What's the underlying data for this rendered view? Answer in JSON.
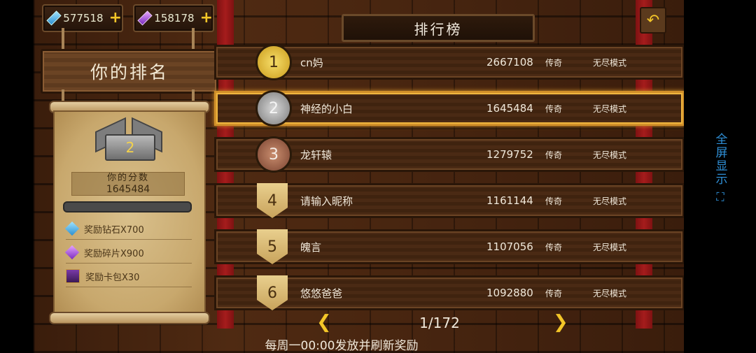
{
  "currency": {
    "diamonds": "577518",
    "shards": "158178",
    "plus": "+"
  },
  "left": {
    "title": "你的排名",
    "rank": "2",
    "score_label": "你的分数",
    "score": "1645484",
    "rewards": [
      {
        "icon": "diamond-icon",
        "label": "奖励钻石X700"
      },
      {
        "icon": "shard-icon",
        "label": "奖励碎片X900"
      },
      {
        "icon": "card-pack-icon",
        "label": "奖励卡包X30"
      }
    ]
  },
  "header": {
    "title": "排行榜",
    "back": "↶"
  },
  "leaderboard": [
    {
      "rank": "1",
      "name": "cn妈",
      "score": "2667108",
      "tier": "传奇",
      "mode": "无尽模式"
    },
    {
      "rank": "2",
      "name": "神经的小白",
      "score": "1645484",
      "tier": "传奇",
      "mode": "无尽模式"
    },
    {
      "rank": "3",
      "name": "龙轩辕",
      "score": "1279752",
      "tier": "传奇",
      "mode": "无尽模式"
    },
    {
      "rank": "4",
      "name": "请输入昵称",
      "score": "1161144",
      "tier": "传奇",
      "mode": "无尽模式"
    },
    {
      "rank": "5",
      "name": "魄言",
      "score": "1107056",
      "tier": "传奇",
      "mode": "无尽模式"
    },
    {
      "rank": "6",
      "name": "悠悠爸爸",
      "score": "1092880",
      "tier": "传奇",
      "mode": "无尽模式"
    }
  ],
  "pager": {
    "prev": "❮",
    "next": "❯",
    "page": "1/172"
  },
  "notice": "每周一00:00发放并刷新奖励",
  "system": {
    "fullscreen": "全屏显示",
    "fullscreen_icon": "⛶"
  },
  "colors": {
    "gold": "#f3c628",
    "selected_border": "#d1902a",
    "system_blue": "#2f8fd6"
  }
}
